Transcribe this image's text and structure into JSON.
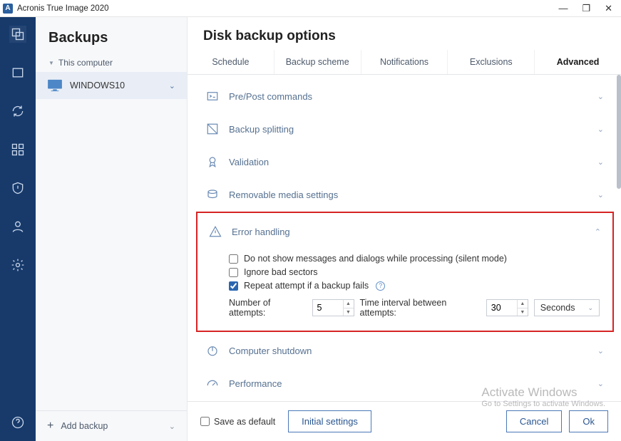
{
  "titlebar": {
    "app_letter": "A",
    "title": "Acronis True Image 2020"
  },
  "sidebar": {
    "heading": "Backups",
    "group_label": "This computer",
    "items": [
      {
        "label": "WINDOWS10"
      }
    ],
    "add_label": "Add backup"
  },
  "main": {
    "title": "Disk backup options",
    "tabs": [
      {
        "label": "Schedule"
      },
      {
        "label": "Backup scheme"
      },
      {
        "label": "Notifications"
      },
      {
        "label": "Exclusions"
      },
      {
        "label": "Advanced"
      }
    ],
    "sections": {
      "prepost": {
        "label": "Pre/Post commands"
      },
      "splitting": {
        "label": "Backup splitting"
      },
      "validation": {
        "label": "Validation"
      },
      "removable": {
        "label": "Removable media settings"
      },
      "error": {
        "label": "Error handling"
      },
      "shutdown": {
        "label": "Computer shutdown"
      },
      "perf": {
        "label": "Performance"
      }
    },
    "error_handling": {
      "silent_label": "Do not show messages and dialogs while processing (silent mode)",
      "ignore_label": "Ignore bad sectors",
      "repeat_label": "Repeat attempt if a backup fails",
      "attempts_label": "Number of attempts:",
      "attempts_value": "5",
      "interval_label": "Time interval between attempts:",
      "interval_value": "30",
      "unit_value": "Seconds"
    }
  },
  "footer": {
    "save_default": "Save as default",
    "initial": "Initial settings",
    "cancel": "Cancel",
    "ok": "Ok"
  },
  "watermark": {
    "line1": "Activate Windows",
    "line2": "Go to Settings to activate Windows."
  }
}
